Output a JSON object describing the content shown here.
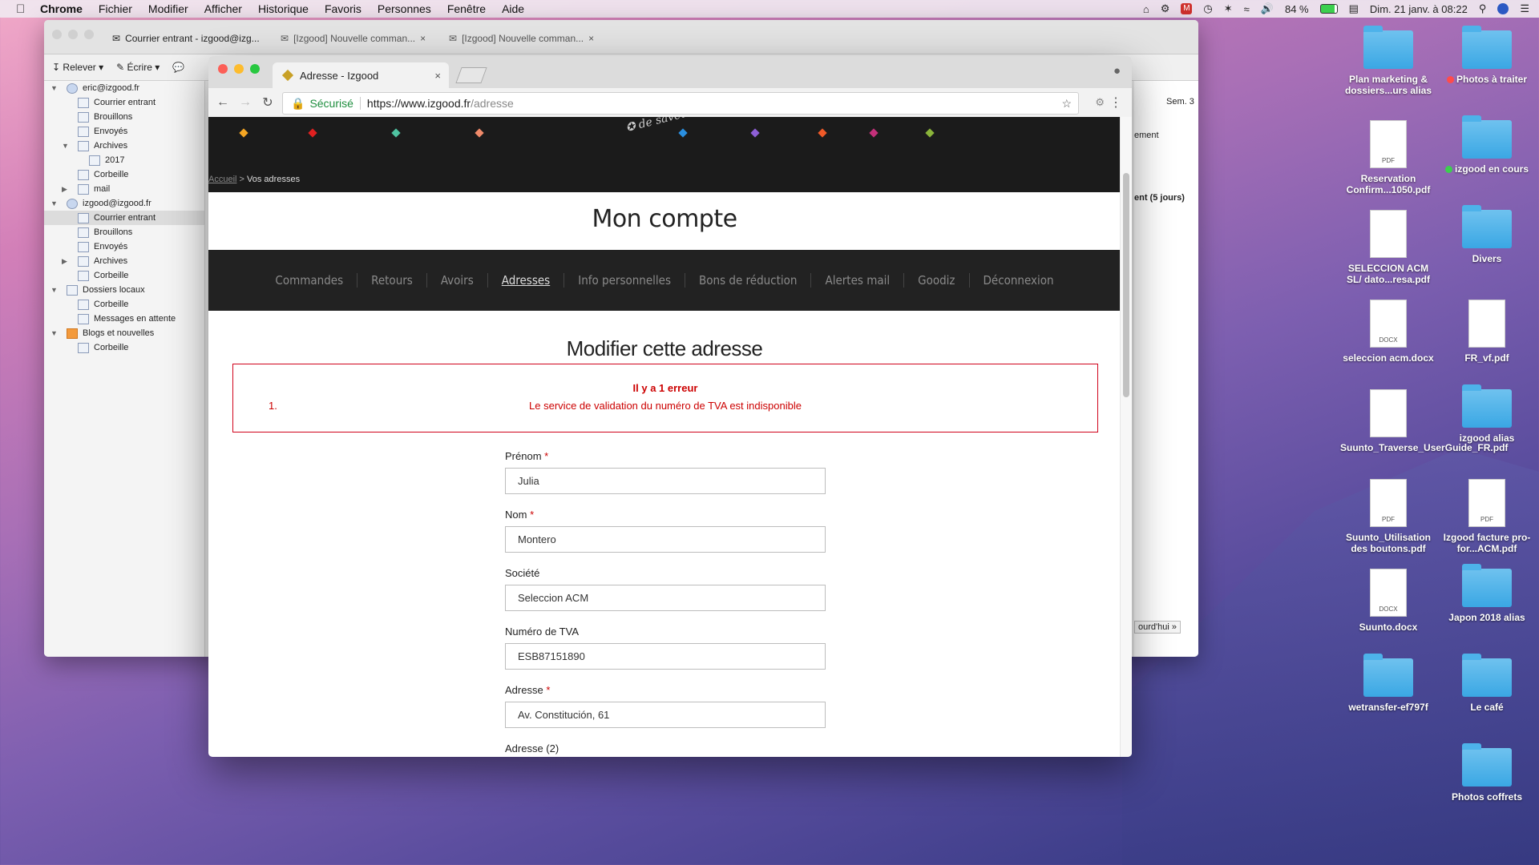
{
  "menubar": {
    "app": "Chrome",
    "items": [
      "Fichier",
      "Modifier",
      "Afficher",
      "Historique",
      "Favoris",
      "Personnes",
      "Fenêtre",
      "Aide"
    ],
    "battery": "84 %",
    "datetime": "Dim. 21 janv. à 08:22"
  },
  "thunderbird": {
    "tabs": [
      "Courrier entrant - izgood@izg...",
      "[Izgood] Nouvelle comman...",
      "[Izgood] Nouvelle comman..."
    ],
    "toolbar": {
      "relever": "Relever",
      "ecrire": "Écrire"
    },
    "folders": [
      {
        "label": "eric@izgood.fr",
        "icon": "globe",
        "level": 0,
        "tri": "▼"
      },
      {
        "label": "Courrier entrant",
        "icon": "box",
        "level": 1
      },
      {
        "label": "Brouillons",
        "icon": "box",
        "level": 1
      },
      {
        "label": "Envoyés",
        "icon": "box",
        "level": 1
      },
      {
        "label": "Archives",
        "icon": "box",
        "level": 1,
        "tri": "▼"
      },
      {
        "label": "2017",
        "icon": "folder",
        "level": 2
      },
      {
        "label": "Corbeille",
        "icon": "box",
        "level": 1
      },
      {
        "label": "mail",
        "icon": "folder",
        "level": 1,
        "tri": "▶"
      },
      {
        "label": "izgood@izgood.fr",
        "icon": "globe",
        "level": 0,
        "tri": "▼"
      },
      {
        "label": "Courrier entrant",
        "icon": "box",
        "level": 1,
        "selected": true
      },
      {
        "label": "Brouillons",
        "icon": "box",
        "level": 1
      },
      {
        "label": "Envoyés",
        "icon": "box",
        "level": 1
      },
      {
        "label": "Archives",
        "icon": "box",
        "level": 1,
        "tri": "▶"
      },
      {
        "label": "Corbeille",
        "icon": "box",
        "level": 1
      },
      {
        "label": "Dossiers locaux",
        "icon": "box",
        "level": 0,
        "tri": "▼"
      },
      {
        "label": "Corbeille",
        "icon": "box",
        "level": 1
      },
      {
        "label": "Messages en attente",
        "icon": "box",
        "level": 1
      },
      {
        "label": "Blogs et nouvelles",
        "icon": "rss",
        "level": 0,
        "tri": "▼"
      },
      {
        "label": "Corbeille",
        "icon": "box",
        "level": 1
      }
    ],
    "right_panel": {
      "week": "Sem. 3",
      "line1": "ement",
      "line2": "ent (5 jours)",
      "today_btn": "ourd'hui »"
    }
  },
  "chrome": {
    "tab_title": "Adresse - Izgood",
    "secure_label": "Sécurisé",
    "url_host": "https://www.izgood.fr",
    "url_path": "/adresse"
  },
  "page": {
    "breadcrumb_home": "Accueil",
    "breadcrumb_sep": ">",
    "breadcrumb_current": "Vos adresses",
    "account_title": "Mon compte",
    "nav": [
      {
        "label": "Commandes",
        "active": false
      },
      {
        "label": "Retours",
        "active": false
      },
      {
        "label": "Avoirs",
        "active": false
      },
      {
        "label": "Adresses",
        "active": true
      },
      {
        "label": "Info personnelles",
        "active": false
      },
      {
        "label": "Bons de réduction",
        "active": false
      },
      {
        "label": "Alertes mail",
        "active": false
      },
      {
        "label": "Goodiz",
        "active": false
      },
      {
        "label": "Déconnexion",
        "active": false
      }
    ],
    "section_title": "Modifier cette adresse",
    "error": {
      "head": "Il y a 1 erreur",
      "num": "1.",
      "message": "Le service de validation du numéro de TVA est indisponible"
    },
    "form": [
      {
        "label": "Prénom",
        "required": true,
        "value": "Julia"
      },
      {
        "label": "Nom",
        "required": true,
        "value": "Montero"
      },
      {
        "label": "Société",
        "required": false,
        "value": "Seleccion ACM"
      },
      {
        "label": "Numéro de TVA",
        "required": false,
        "value": "ESB87151890"
      },
      {
        "label": "Adresse",
        "required": true,
        "value": "Av. Constitución, 61"
      },
      {
        "label": "Adresse (2)",
        "required": false,
        "value": ""
      }
    ],
    "diamond_colors": [
      "#f5a623",
      "#e02020",
      "#4fc3a1",
      "#f08a6a",
      "#2a8fe0",
      "#8e5fd6",
      "#f05a28",
      "#c4307a",
      "#8ab43a"
    ]
  },
  "desktop": [
    {
      "label": "Plan marketing & dossiers...urs alias",
      "type": "folder"
    },
    {
      "label": "Photos à traiter",
      "type": "folder",
      "dot": "#ff4b4b"
    },
    {
      "label": "Reservation Confirm...1050.pdf",
      "type": "doc",
      "ext": "PDF"
    },
    {
      "label": "izgood en cours",
      "type": "folder",
      "dot": "#3ccf4e"
    },
    {
      "label": "SELECCION ACM SL/ dato...resa.pdf",
      "type": "doc",
      "ext": ""
    },
    {
      "label": "Divers",
      "type": "folder"
    },
    {
      "label": "seleccion acm.docx",
      "type": "doc",
      "ext": "DOCX"
    },
    {
      "label": "FR_vf.pdf",
      "type": "doc",
      "ext": ""
    },
    {
      "label": "Suunto_Traverse_UserGuide_FR.pdf",
      "type": "doc",
      "ext": ""
    },
    {
      "label": "izgood alias",
      "type": "folder"
    },
    {
      "label": "Suunto_Utilisation des boutons.pdf",
      "type": "doc",
      "ext": "PDF"
    },
    {
      "label": "Izgood facture pro-for...ACM.pdf",
      "type": "doc",
      "ext": "PDF"
    },
    {
      "label": "Suunto.docx",
      "type": "doc",
      "ext": "DOCX"
    },
    {
      "label": "Japon 2018 alias",
      "type": "folder"
    },
    {
      "label": "wetransfer-ef797f",
      "type": "folder"
    },
    {
      "label": "Le café",
      "type": "folder"
    },
    {
      "label": "Photos coffrets",
      "type": "folder"
    }
  ]
}
